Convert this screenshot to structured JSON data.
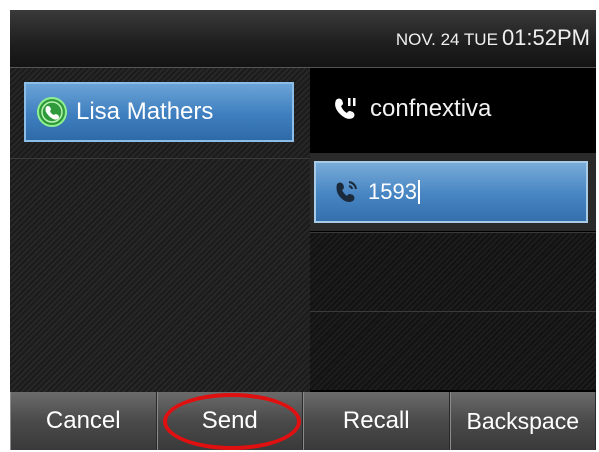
{
  "status_bar": {
    "date": "NOV. 24 TUE",
    "time": "01:52PM"
  },
  "line_key": {
    "label": "Lisa Mathers",
    "icon": "phone-handset-icon-green"
  },
  "call": {
    "label": "confnextiva",
    "icon": "phone-handset-icon"
  },
  "dial_input": {
    "value": "1593",
    "icon": "phone-outgoing-icon"
  },
  "softkeys": [
    {
      "label": "Cancel"
    },
    {
      "label": "Send"
    },
    {
      "label": "Recall"
    },
    {
      "label": "Backspace"
    }
  ],
  "colors": {
    "selected_blue": "#4684c2",
    "annotation_red": "#e01010",
    "status_green": "#3cc24a"
  }
}
